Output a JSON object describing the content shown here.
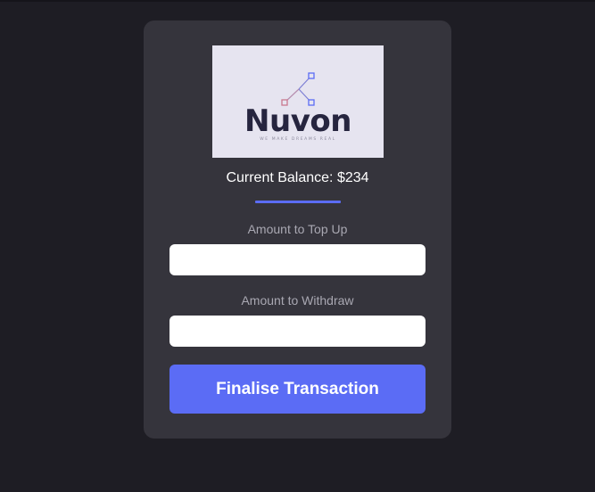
{
  "logo": {
    "wordmark": "Nuvon",
    "tagline": "WE MAKE DREAMS REAL",
    "colors": {
      "background": "#e6e4f0",
      "wordmark": "#26253f",
      "node_accent": "#5b6cf5",
      "node_warm": "#c9788f"
    }
  },
  "balance": {
    "label": "Current Balance:",
    "value": "$234"
  },
  "top_up": {
    "label": "Amount to Top Up",
    "value": "",
    "placeholder": ""
  },
  "withdraw": {
    "label": "Amount to Withdraw",
    "value": "",
    "placeholder": ""
  },
  "submit": {
    "label": "Finalise Transaction"
  },
  "colors": {
    "page_background": "#1e1d24",
    "card_background": "#35343c",
    "accent": "#5b6cf5",
    "label_text": "#a9a8b2"
  }
}
